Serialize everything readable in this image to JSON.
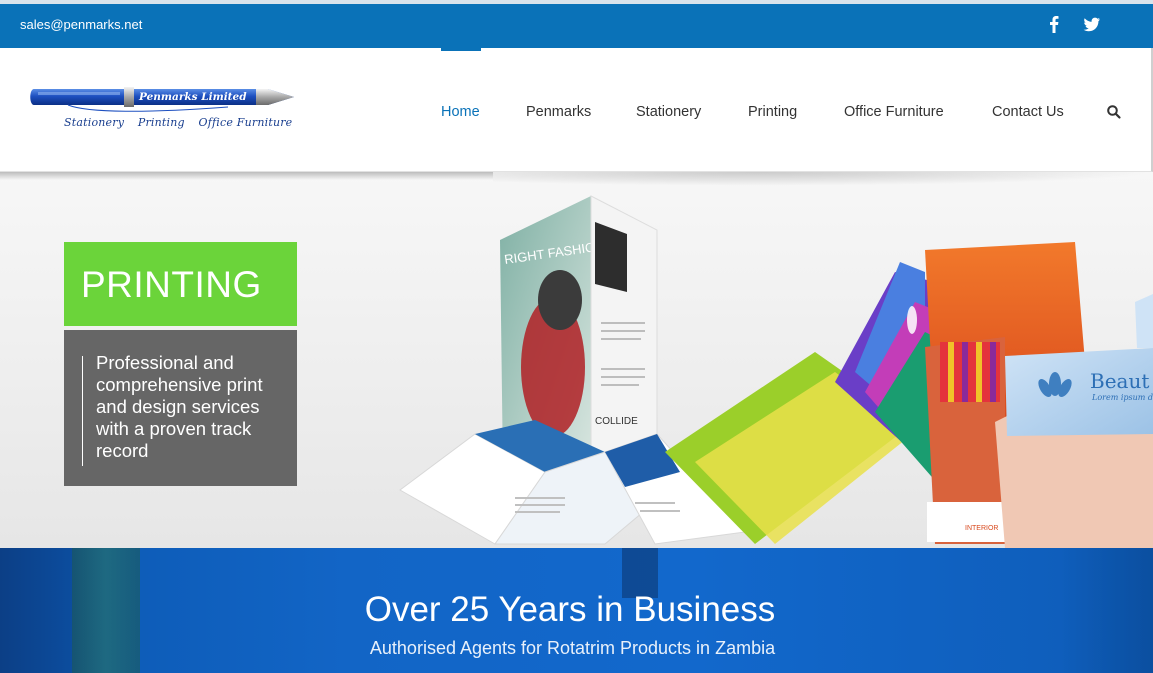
{
  "topbar": {
    "email": "sales@penmarks.net",
    "social": [
      {
        "name": "facebook-icon",
        "glyph": "f"
      },
      {
        "name": "twitter-icon",
        "glyph": "twitter"
      }
    ],
    "background": "#0a72b8"
  },
  "logo": {
    "brand": "Penmarks Limited",
    "tagline": [
      "Stationery",
      "Printing",
      "Office Furniture"
    ]
  },
  "nav": {
    "items": [
      {
        "label": "Home",
        "active": true
      },
      {
        "label": "Penmarks",
        "active": false
      },
      {
        "label": "Stationery",
        "active": false
      },
      {
        "label": "Printing",
        "active": false
      },
      {
        "label": "Office Furniture",
        "active": false
      },
      {
        "label": "Contact Us",
        "active": false
      }
    ],
    "search_icon": "search-icon",
    "accent": "#0a72b8"
  },
  "hero": {
    "title": "PRINTING",
    "description": "Professional and comprehensive print and design services with a proven track record",
    "title_bg": "#6bd43a",
    "desc_bg": "#666666",
    "art": {
      "brochure_title": "RIGHT FASHION STORE",
      "brochure_collide": "COLLIDE",
      "card_text": "Beaut",
      "card_sub": "Lorem ipsum d",
      "interior": "INTERIOR"
    }
  },
  "banner": {
    "title": "Over 25 Years in Business",
    "subtitle": "Authorised Agents for Rotatrim Products in Zambia"
  }
}
